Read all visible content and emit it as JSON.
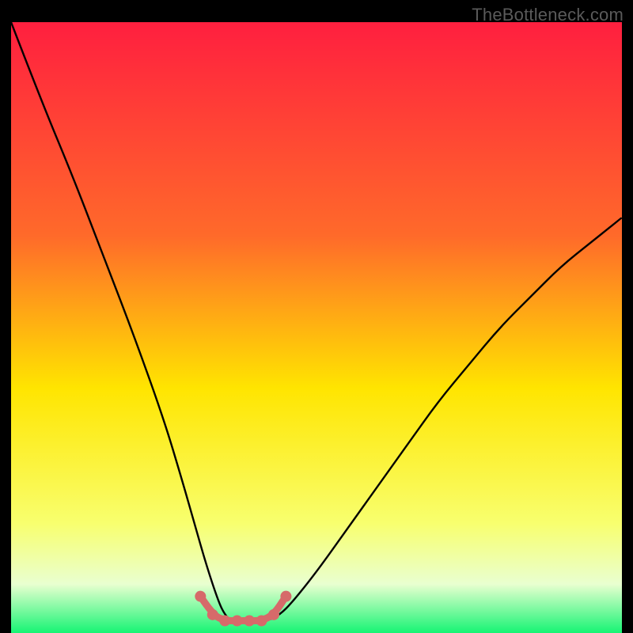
{
  "watermark": "TheBottleneck.com",
  "colors": {
    "background": "#000000",
    "gradient_top": "#ff1f3f",
    "gradient_mid_top": "#ff6a2a",
    "gradient_mid": "#ffe500",
    "gradient_mid_low": "#f8ff6e",
    "gradient_low": "#e9ffd0",
    "gradient_bottom": "#16f474",
    "curve": "#000000",
    "marker_stroke": "#d66a6a",
    "marker_fill": "#d66a6a"
  },
  "chart_data": {
    "type": "line",
    "title": "",
    "xlabel": "",
    "ylabel": "",
    "xlim": [
      0,
      100
    ],
    "ylim": [
      0,
      100
    ],
    "series": [
      {
        "name": "bottleneck-curve",
        "x": [
          0,
          5,
          10,
          15,
          20,
          25,
          28,
          30,
          32,
          34,
          35,
          36,
          38,
          40,
          42,
          44,
          46,
          50,
          55,
          60,
          65,
          70,
          75,
          80,
          85,
          90,
          95,
          100
        ],
        "values": [
          100,
          87,
          75,
          62,
          49,
          35,
          25,
          18,
          11,
          5,
          3,
          2,
          2,
          2,
          2,
          3,
          5,
          10,
          17,
          24,
          31,
          38,
          44,
          50,
          55,
          60,
          64,
          68
        ]
      }
    ],
    "highlighted_region": {
      "name": "optimal-zone",
      "x": [
        31,
        33,
        35,
        37,
        39,
        41,
        43,
        45
      ],
      "values": [
        6,
        3,
        2,
        2,
        2,
        2,
        3,
        6
      ]
    }
  }
}
